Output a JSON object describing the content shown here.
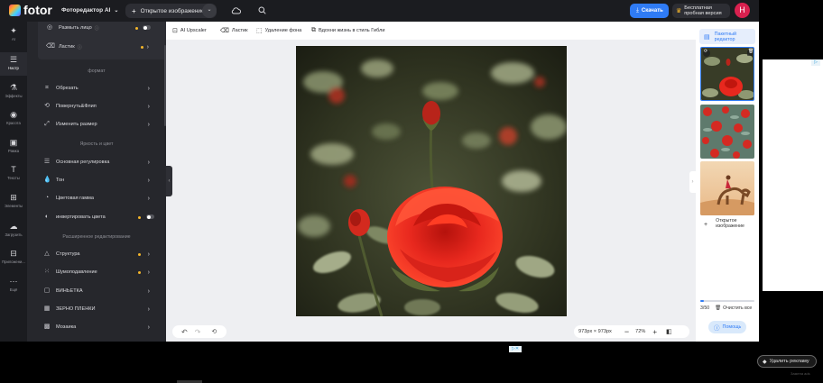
{
  "header": {
    "logo_text": "fotor",
    "editor_menu": "Фоторедактор AI",
    "open_image": "Открытое изображение",
    "download": "Скачать",
    "trial_line1": "Бесплатная",
    "trial_line2": "пробная версия",
    "avatar_letter": "Н"
  },
  "rail": [
    {
      "label": "AI",
      "icon": "sparkle-icon"
    },
    {
      "label": "Настр",
      "icon": "sliders-icon"
    },
    {
      "label": "Эффекты",
      "icon": "flask-icon"
    },
    {
      "label": "Красота",
      "icon": "eye-icon"
    },
    {
      "label": "Рамка",
      "icon": "frame-icon"
    },
    {
      "label": "Тексты",
      "icon": "text-icon"
    },
    {
      "label": "Элементы",
      "icon": "shapes-icon"
    },
    {
      "label": "Загрузить",
      "icon": "cloud-upload-icon"
    },
    {
      "label": "Приложени...",
      "icon": "apps-icon"
    },
    {
      "label": "Ещё",
      "icon": "more-icon"
    }
  ],
  "panel": {
    "top_items": [
      {
        "label": "Размыть лицо",
        "info": "ⓘ"
      },
      {
        "label": "Ластик",
        "info": "ⓘ"
      }
    ],
    "section_format": "формат",
    "format_items": [
      "Обрезать",
      "Повернуть&Флип",
      "Изменить размер"
    ],
    "section_light": "Яркость и цвет",
    "light_items": [
      "Основная регулировка",
      "Тон",
      "Цветовая гамма",
      "инвертировать цвета"
    ],
    "section_adv": "Расширенное редактирование",
    "adv_items": [
      "Структура",
      "Шумоподавление",
      "ВИНЬЕТКА",
      "ЗЕРНО ПЛЕНКИ",
      "Мозаика"
    ]
  },
  "toolbar": {
    "upscaler": "AI Upscaler",
    "eraser": "Ластик",
    "bg_remove": "Удаление фона",
    "ghibli": "Вдохни жизнь в стиль Гибли"
  },
  "bottom": {
    "dimensions": "973px × 973px",
    "zoom": "72%"
  },
  "right": {
    "batch_line1": "Пакетный",
    "batch_line2": "редактор",
    "open_line1": "Открытое",
    "open_line2": "изображение",
    "count": "3/50",
    "clear": "Очистить все",
    "help": "Помощь"
  },
  "footer": {
    "remove_ads": "Удалить рекламу",
    "tiny_text": "Замена ads"
  },
  "colors": {
    "dark_bg": "#1b1c20",
    "panel_bg": "#26272c",
    "accent_blue": "#2f7bf5",
    "rose_red": "#e8281e"
  }
}
